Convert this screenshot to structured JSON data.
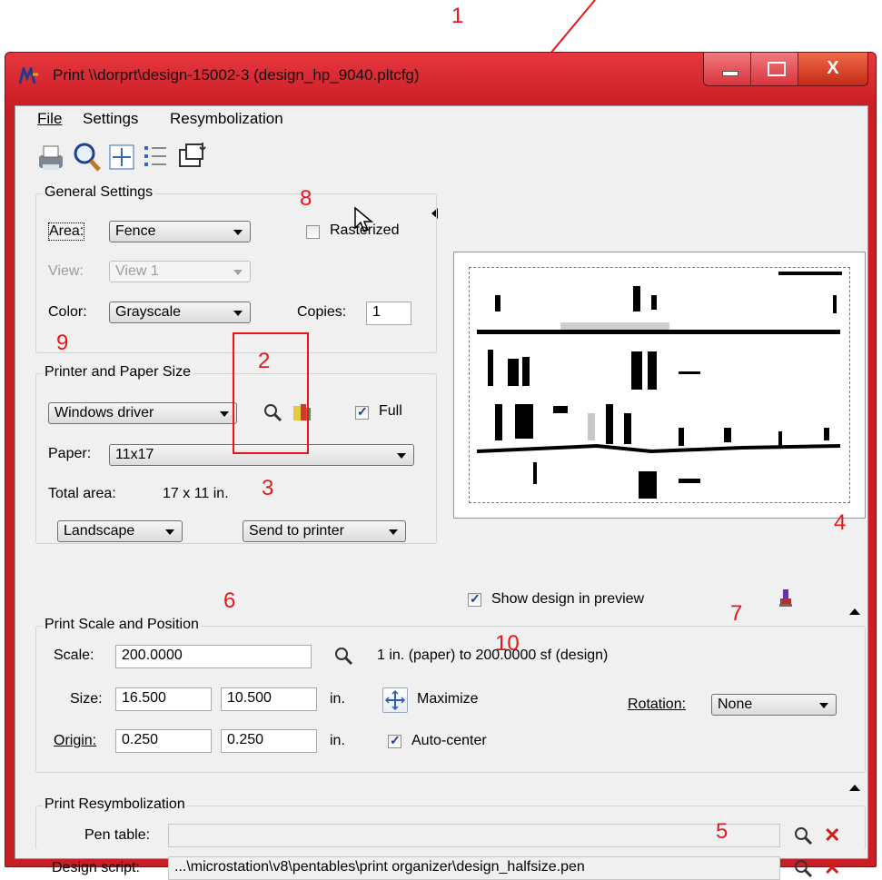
{
  "window": {
    "title": "Print  \\\\dorprt\\design-15002-3  (design_hp_9040.pltcfg)",
    "close_label": "X"
  },
  "menu": {
    "file": "File",
    "settings": "Settings",
    "resymbolization": "Resymbolization"
  },
  "toolbar": {
    "icons": [
      "printer-icon",
      "preview-magnify-icon",
      "fit-icon",
      "list-icon",
      "export-icon",
      "cursor-icon",
      "collapse-left-icon"
    ]
  },
  "general": {
    "title": "General Settings",
    "area_label": "Area:",
    "area_value": "Fence",
    "view_label": "View:",
    "view_value": "View 1",
    "color_label": "Color:",
    "color_value": "Grayscale",
    "rasterized_label": "Rasterized",
    "rasterized": false,
    "copies_label": "Copies:",
    "copies_value": "1"
  },
  "printer": {
    "title": "Printer and Paper Size",
    "driver_value": "Windows driver",
    "full_label": "Full",
    "full": true,
    "paper_label": "Paper:",
    "paper_value": "11x17",
    "total_area_label": "Total area:",
    "total_area_value": "17 x 11 in.",
    "orientation_value": "Landscape",
    "send_value": "Send to printer"
  },
  "preview": {
    "show_design_label": "Show design in preview",
    "show_design": true
  },
  "scale": {
    "title": "Print Scale and Position",
    "scale_label": "Scale:",
    "scale_value": "200.0000",
    "scale_text": "1 in. (paper) to 200.0000 sf (design)",
    "size_label": "Size:",
    "size_w": "16.500",
    "size_h": "10.500",
    "size_unit": "in.",
    "maximize_label": "Maximize",
    "origin_label": "Origin:",
    "origin_x": "0.250",
    "origin_y": "0.250",
    "origin_unit": "in.",
    "autocenter_label": "Auto-center",
    "autocenter": true,
    "rotation_label": "Rotation:",
    "rotation_value": "None"
  },
  "resym": {
    "title": "Print Resymbolization",
    "pen_label": "Pen table:",
    "pen_value": "",
    "script_label": "Design script:",
    "script_value": "...\\microstation\\v8\\pentables\\print organizer\\design_halfsize.pen"
  },
  "annotations": [
    "1",
    "2",
    "3",
    "4",
    "5",
    "6",
    "7",
    "8",
    "9",
    "10"
  ],
  "colors": {
    "annotation": "#e8161c",
    "title_bar": "#c81e26"
  }
}
